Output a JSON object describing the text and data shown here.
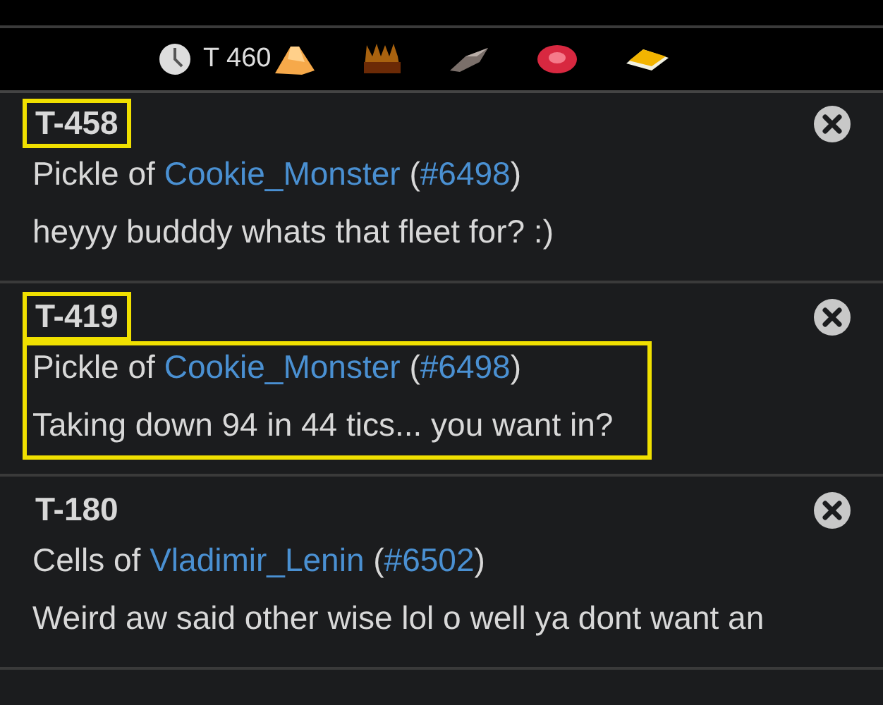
{
  "toolbar": {
    "turn": "T 460",
    "resources": [
      {
        "kind": "sand"
      },
      {
        "kind": "grain"
      },
      {
        "kind": "ore"
      },
      {
        "kind": "gem"
      },
      {
        "kind": "plate"
      }
    ]
  },
  "messages": [
    {
      "turn": "T-458",
      "turn_highlighted": true,
      "prefix": "Pickle of",
      "sender": "Cookie_Monster",
      "open": " (",
      "id": "#6498",
      "close": ")",
      "body": "heyyy budddy whats that fleet for? :)",
      "body_highlighted": false
    },
    {
      "turn": "T-419",
      "turn_highlighted": true,
      "prefix": "Pickle of",
      "sender": "Cookie_Monster",
      "open": " (",
      "id": "#6498",
      "close": ")",
      "body": "Taking down 94 in 44 tics... you want in?",
      "body_highlighted": true
    },
    {
      "turn": "T-180",
      "turn_highlighted": false,
      "prefix": "Cells of",
      "sender": "Vladimir_Lenin",
      "open": " (",
      "id": "#6502",
      "close": ")",
      "body": "Weird aw said other wise lol o well ya dont want an",
      "body_highlighted": false
    }
  ]
}
